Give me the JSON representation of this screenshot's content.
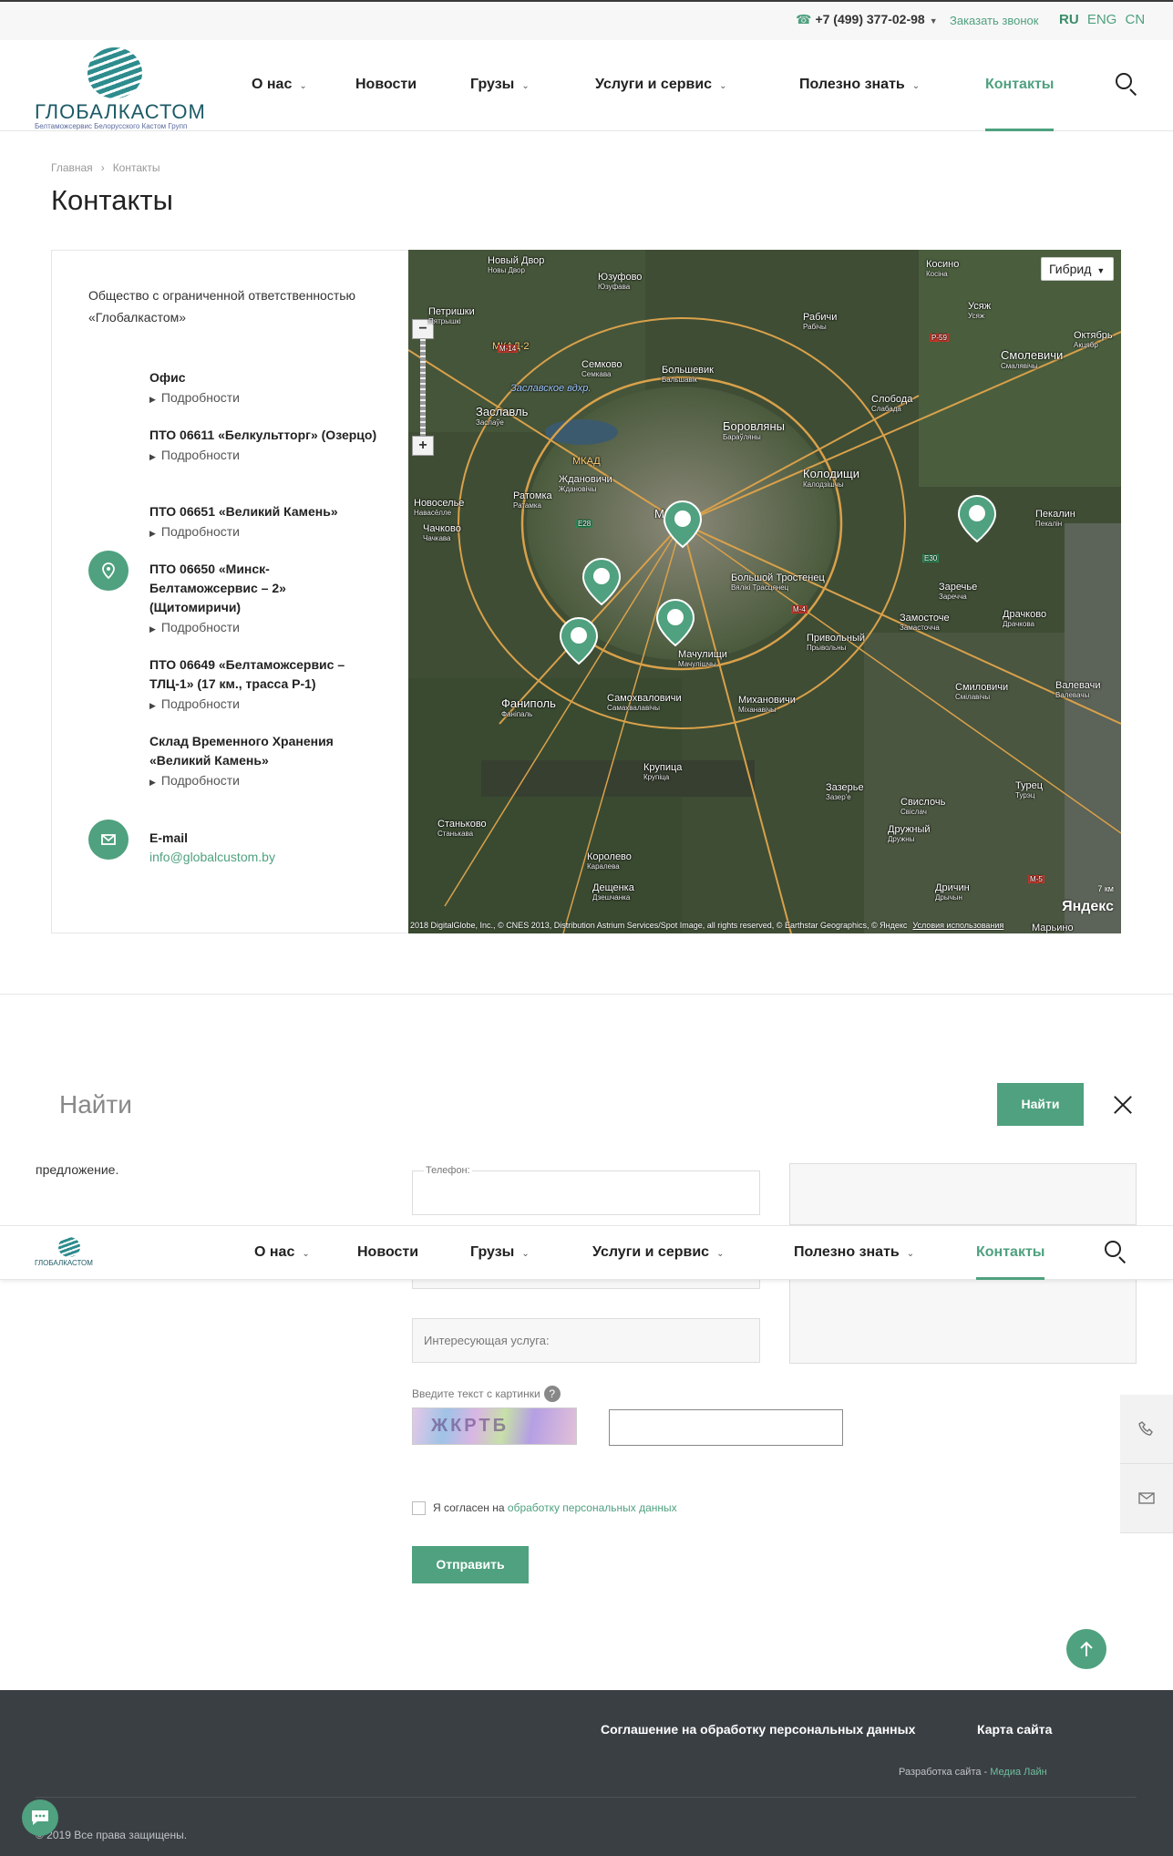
{
  "topbar": {
    "phone": "+7 (499) 377-02-98",
    "callback": "Заказать звонок",
    "langs": [
      "RU",
      "ENG",
      "CN"
    ],
    "active_lang": "RU"
  },
  "logo": {
    "name": "ГЛОБАЛКАСТОМ",
    "tagline": "Белтаможсервис Белорусского Кастом Групп"
  },
  "nav": {
    "items": [
      {
        "label": "О нас",
        "has_dropdown": true
      },
      {
        "label": "Новости",
        "has_dropdown": false
      },
      {
        "label": "Грузы",
        "has_dropdown": true
      },
      {
        "label": "Услуги и сервис",
        "has_dropdown": true
      },
      {
        "label": "Полезно знать",
        "has_dropdown": true
      },
      {
        "label": "Контакты",
        "has_dropdown": false,
        "active": true
      }
    ]
  },
  "breadcrumb": {
    "home": "Главная",
    "current": "Контакты"
  },
  "page_title": "Контакты",
  "contacts": {
    "company": "Общество с ограниченной ответственностью «Глобалкастом»",
    "more_label": "Подробности",
    "offices": [
      "Офис",
      "ПТО 06611 «Белкультторг» (Озерцо)",
      "ПТО 06651 «Великий Камень»",
      "ПТО 06650 «Минск-Белтаможсервис – 2» (Щитомиричи)",
      "ПТО 06649 «Белтаможсервис – ТЛЦ-1» (17 км., трасса Р-1)",
      "Склад Временного Хранения «Великий Камень»"
    ],
    "email_label": "E-mail",
    "email": "info@globalcustom.by"
  },
  "map": {
    "type_selector": "Гибрид",
    "water": "Заславское вдхр.",
    "labels": [
      {
        "name": "Новый Двор",
        "sub": "Новы Двор"
      },
      {
        "name": "Юзуфово",
        "sub": "Юзуфава"
      },
      {
        "name": "Косино",
        "sub": "Косіна"
      },
      {
        "name": "Петришки",
        "sub": "Пятрышкі"
      },
      {
        "name": "Рабичи",
        "sub": "Рабічы"
      },
      {
        "name": "Усяж",
        "sub": "Усяж"
      },
      {
        "name": "Октябрь",
        "sub": "Акцябр"
      },
      {
        "name": "Семково",
        "sub": "Семкава"
      },
      {
        "name": "Большевик",
        "sub": "Бальшавік"
      },
      {
        "name": "Смолевичи",
        "sub": "Смалявічы"
      },
      {
        "name": "Заславль",
        "sub": "Заслаўе"
      },
      {
        "name": "Боровляны",
        "sub": "Бараўляны"
      },
      {
        "name": "Слобода",
        "sub": "Слабада"
      },
      {
        "name": "Колодищи",
        "sub": "Калодзішчы"
      },
      {
        "name": "Ждановичи",
        "sub": "Ждановічы"
      },
      {
        "name": "Ратомка",
        "sub": "Ратамка"
      },
      {
        "name": "Новоселье",
        "sub": "Навасёлле"
      },
      {
        "name": "Чачково",
        "sub": "Чачкава"
      },
      {
        "name": "Минск",
        "sub": ""
      },
      {
        "name": "Пекалин",
        "sub": "Пекалін"
      },
      {
        "name": "Большой Тростенец",
        "sub": "Вялікі Трасцянец"
      },
      {
        "name": "Заречье",
        "sub": "Заречча"
      },
      {
        "name": "Замосточе",
        "sub": "Замасточчa"
      },
      {
        "name": "Драчково",
        "sub": "Драчкова"
      },
      {
        "name": "Привольный",
        "sub": "Прывольны"
      },
      {
        "name": "Мачулищи",
        "sub": "Мачулішчы"
      },
      {
        "name": "Смиловичи",
        "sub": "Смілавічы"
      },
      {
        "name": "Валевачи",
        "sub": "Валевачы"
      },
      {
        "name": "Фаниполь",
        "sub": "Фаніпаль"
      },
      {
        "name": "Самохваловичи",
        "sub": "Самахвалавічы"
      },
      {
        "name": "Михановичи",
        "sub": "Міханавічы"
      },
      {
        "name": "Крупица",
        "sub": "Крупіца"
      },
      {
        "name": "Зазерье",
        "sub": "Зазер'е"
      },
      {
        "name": "Свислочь",
        "sub": "Свіслач"
      },
      {
        "name": "Турец",
        "sub": "Турэц"
      },
      {
        "name": "Дружный",
        "sub": "Дружны"
      },
      {
        "name": "Станьково",
        "sub": "Станькава"
      },
      {
        "name": "Королево",
        "sub": "Каралева"
      },
      {
        "name": "Дещенка",
        "sub": "Дзешчанка"
      },
      {
        "name": "Дричин",
        "sub": "Дрычын"
      },
      {
        "name": "Марьино",
        "sub": ""
      }
    ],
    "roads": [
      "МКАД-2",
      "МКАД",
      "М-14",
      "М-4",
      "Е30",
      "Е28",
      "Р-59",
      "М-5"
    ],
    "scale": "7 км",
    "brand": "Яндекс",
    "copyright": "2018 DigitalGlobe, Inc., © CNES 2013, Distribution Astrium Services/Spot Image, all rights reserved, © Earthstar Geographics, © Яндекс",
    "terms": "Условия использования"
  },
  "search": {
    "placeholder": "Найти",
    "button": "Найти"
  },
  "form": {
    "offer_text": "предложение.",
    "phone_label": "Телефон:",
    "service_placeholder": "Интересующая услуга:",
    "captcha_label": "Введите текст с картинки",
    "captcha_help": "?",
    "consent_text": "Я согласен на",
    "consent_link": "обработку персональных данных",
    "submit": "Отправить"
  },
  "footer": {
    "agreement": "Соглашение на обработку персональных данных",
    "sitemap": "Карта сайта",
    "dev_text": "Разработка сайта -",
    "dev_link": "Медиа Лайн",
    "copyright": "© 2019 Все права защищены."
  },
  "colors": {
    "accent": "#4fa17f",
    "footer_bg": "#3a3f44"
  }
}
